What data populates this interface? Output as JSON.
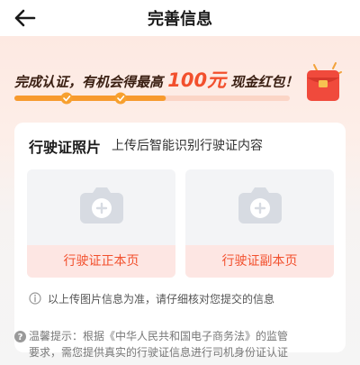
{
  "header": {
    "title": "完善信息",
    "back_icon": "arrow-left-icon"
  },
  "promo": {
    "text_before": "完成认证，有机会得最高",
    "amount": "100元",
    "text_after": "现金红包！",
    "icon": "red-envelope-icon",
    "accent": "#f2502d",
    "steps_completed": 2,
    "progress_fraction": 0.55
  },
  "card": {
    "title": "行驶证照片",
    "subtitle": "上传后智能识别行驶证内容",
    "uploads": [
      {
        "label": "行驶证正本页",
        "icon": "camera-add-icon"
      },
      {
        "label": "行驶证副本页",
        "icon": "camera-add-icon"
      }
    ],
    "notice": "以上传图片信息为准，请仔细核对您提交的信息"
  },
  "footnote": {
    "icon": "help-icon",
    "line1": "温馨提示：根据《中华人民共和国电子商务法》的监管",
    "line2": "要求，需您提供真实的行驶证信息进行司机身份证认证"
  }
}
